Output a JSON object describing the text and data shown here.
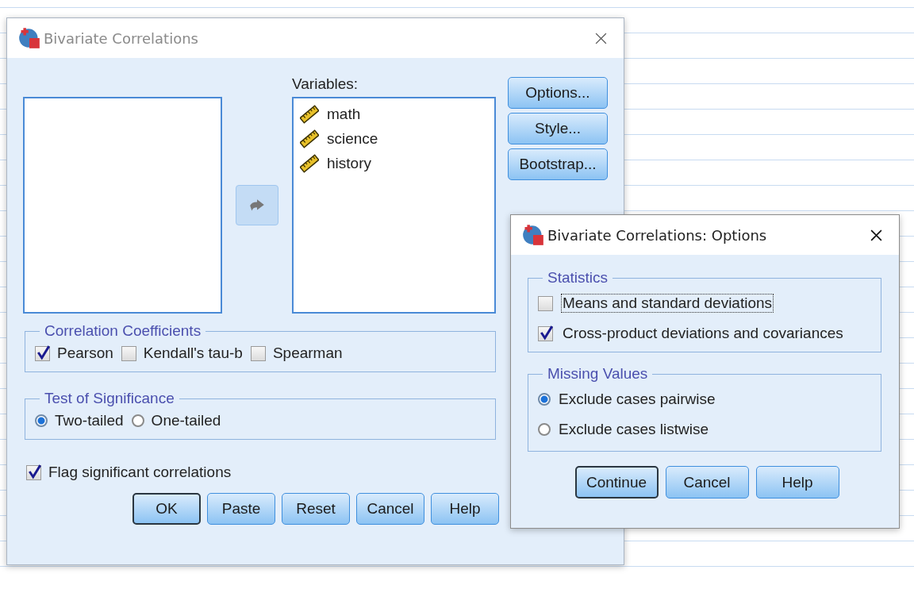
{
  "main_dialog": {
    "title": "Bivariate Correlations",
    "variables_label": "Variables:",
    "variables": [
      "math",
      "science",
      "history"
    ],
    "side_buttons": [
      "Options...",
      "Style...",
      "Bootstrap..."
    ],
    "correlation_coefficients": {
      "title": "Correlation Coefficients",
      "options": [
        {
          "label": "Pearson",
          "checked": true
        },
        {
          "label": "Kendall's tau-b",
          "checked": false
        },
        {
          "label": "Spearman",
          "checked": false
        }
      ]
    },
    "test_of_significance": {
      "title": "Test of Significance",
      "options": [
        {
          "label": "Two-tailed",
          "selected": true
        },
        {
          "label": "One-tailed",
          "selected": false
        }
      ]
    },
    "flag": {
      "label": "Flag significant correlations",
      "checked": true
    },
    "buttons": [
      {
        "label": "OK",
        "default": true
      },
      {
        "label": "Paste",
        "default": false
      },
      {
        "label": "Reset",
        "default": false
      },
      {
        "label": "Cancel",
        "default": false
      },
      {
        "label": "Help",
        "default": false
      }
    ]
  },
  "options_dialog": {
    "title": "Bivariate Correlations: Options",
    "statistics": {
      "title": "Statistics",
      "options": [
        {
          "label": "Means and standard deviations",
          "checked": false,
          "focused": true
        },
        {
          "label": "Cross-product deviations and covariances",
          "checked": true,
          "focused": false
        }
      ]
    },
    "missing_values": {
      "title": "Missing Values",
      "options": [
        {
          "label": "Exclude cases pairwise",
          "selected": true
        },
        {
          "label": "Exclude cases listwise",
          "selected": false
        }
      ]
    },
    "buttons": [
      {
        "label": "Continue",
        "default": true
      },
      {
        "label": "Cancel",
        "default": false
      },
      {
        "label": "Help",
        "default": false
      }
    ]
  }
}
